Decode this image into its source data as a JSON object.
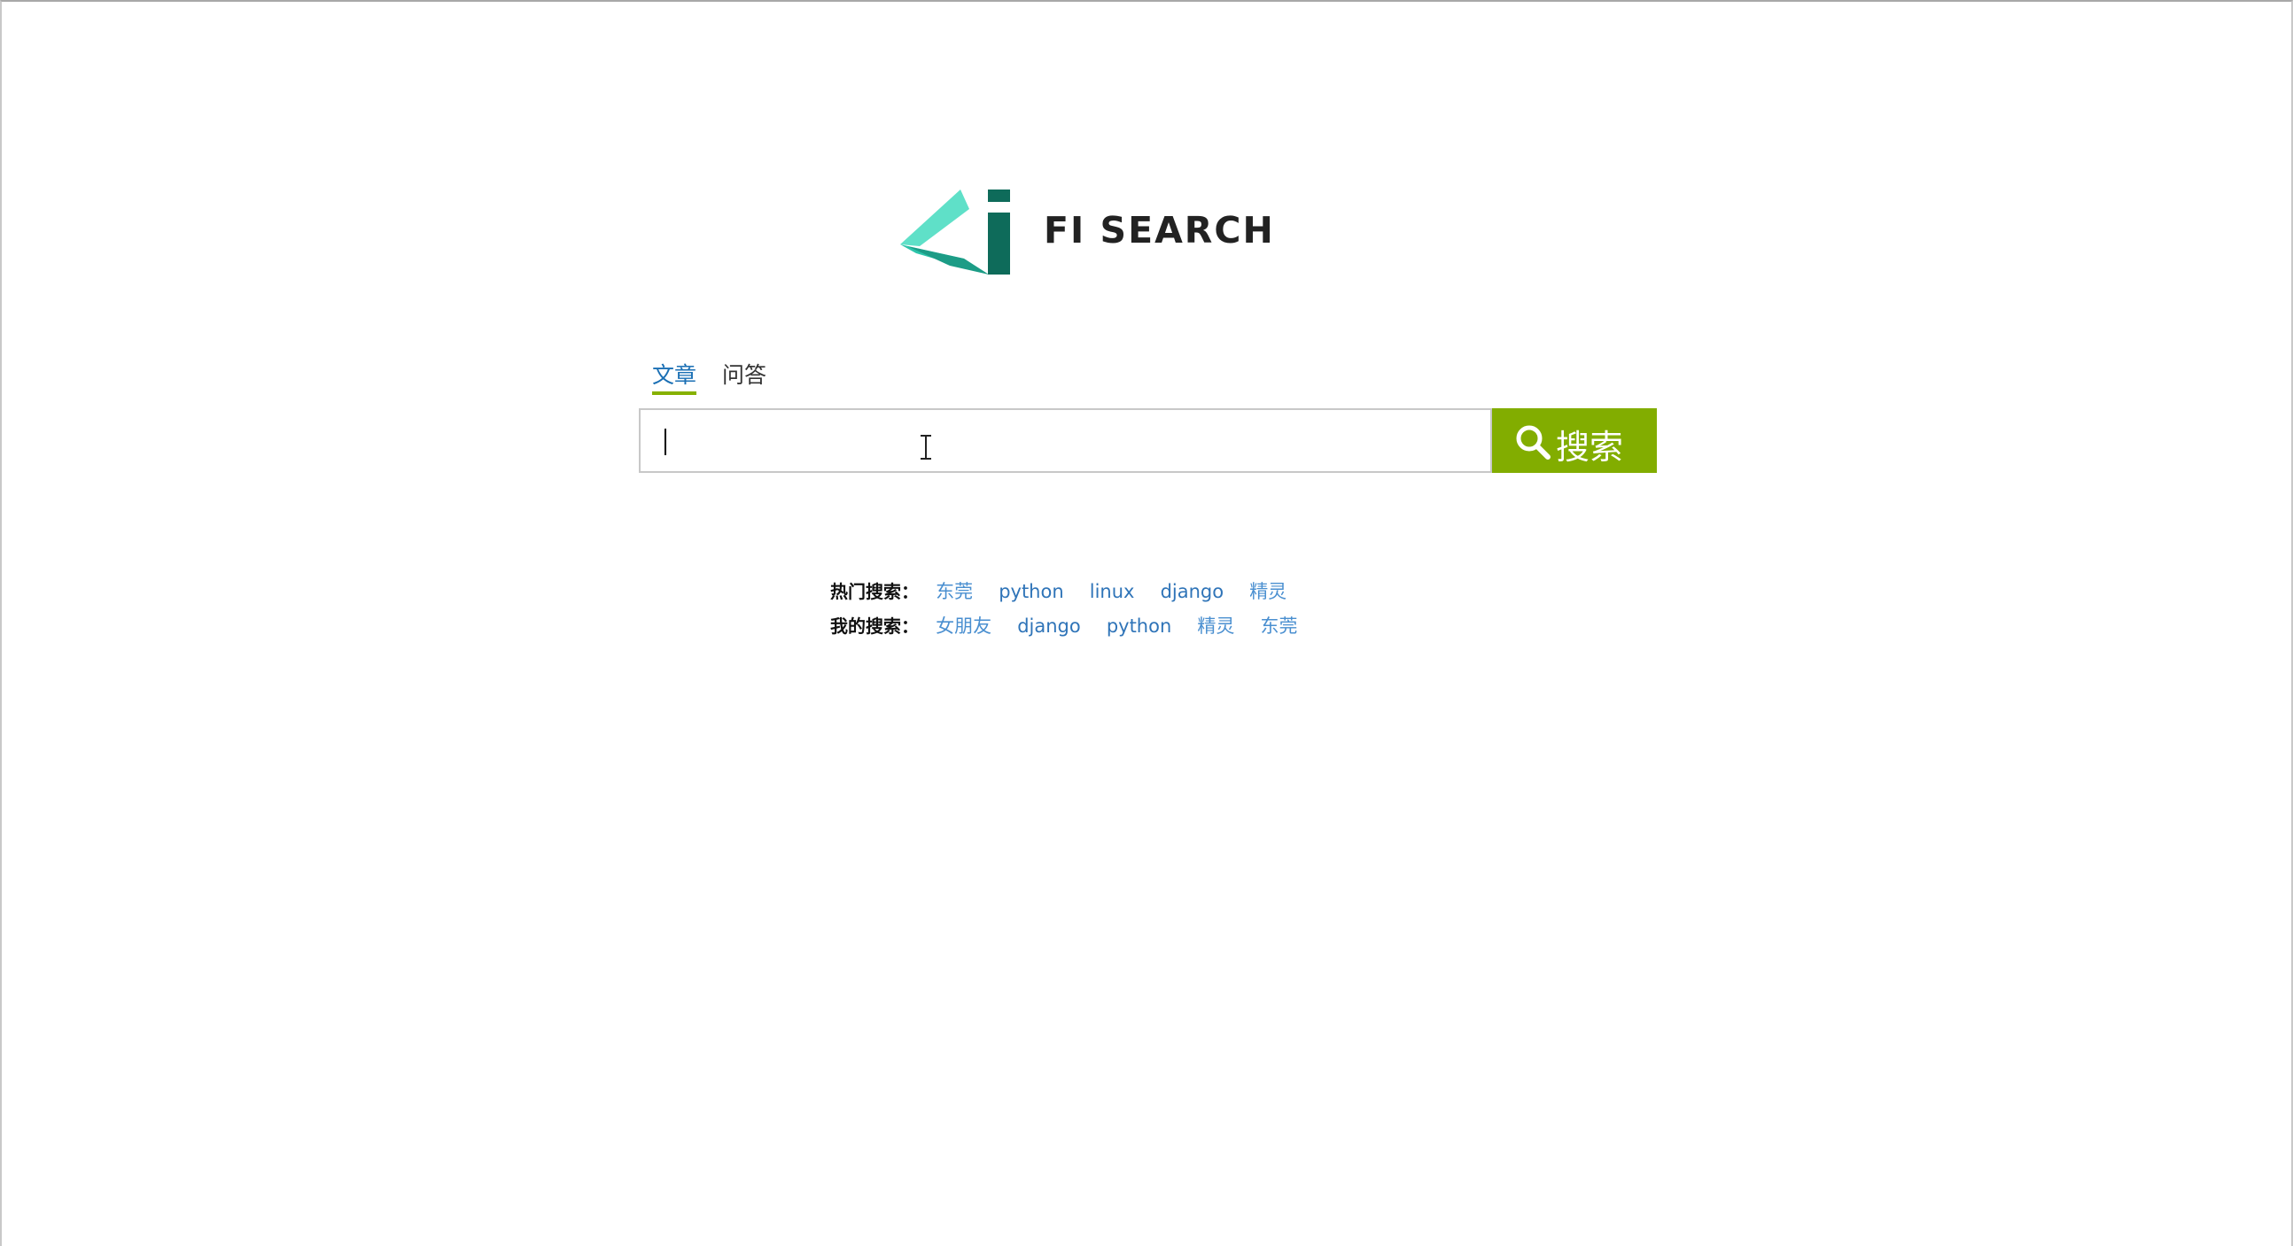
{
  "brand": {
    "name": "FI SEARCH",
    "colors": {
      "teal_light": "#5fe0c8",
      "teal_mid": "#2cc4aa",
      "teal_dark": "#0e6b5a"
    }
  },
  "tabs": [
    {
      "label": "文章",
      "active": true
    },
    {
      "label": "问答",
      "active": false
    }
  ],
  "search": {
    "value": "",
    "placeholder": "",
    "button_label": "搜索",
    "button_color": "#82ad00"
  },
  "hot_searches": {
    "label": "热门搜索：",
    "items": [
      "东莞",
      "python",
      "linux",
      "django",
      "精灵"
    ]
  },
  "my_searches": {
    "label": "我的搜索：",
    "items": [
      "女朋友",
      "django",
      "python",
      "精灵",
      "东莞"
    ]
  }
}
